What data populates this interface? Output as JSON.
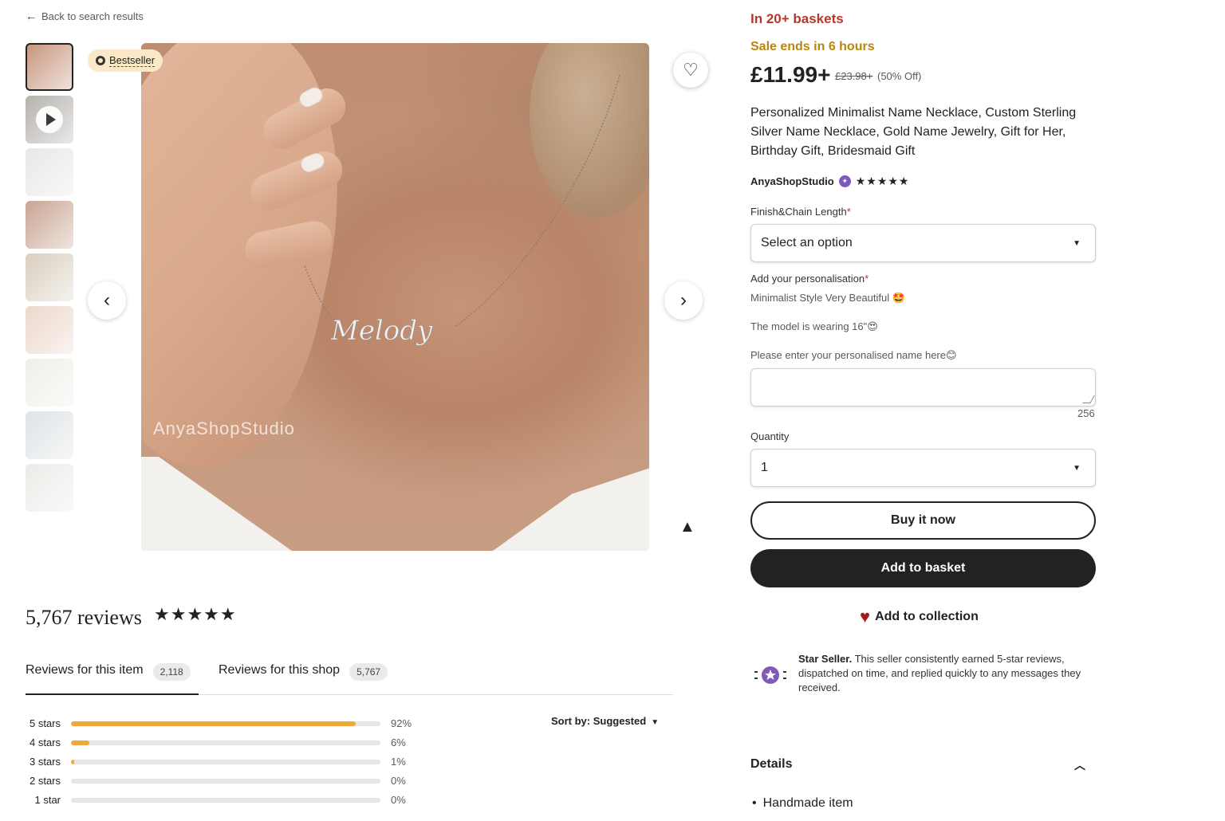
{
  "nav": {
    "back_label": "Back to search results"
  },
  "gallery": {
    "bestseller_label": "Bestseller",
    "watermark": "AnyaShopStudio",
    "necklace_name": "Melody",
    "thumbnails": [
      {
        "color": "#c7977e"
      },
      {
        "color": "#b5b1ad",
        "video": true
      },
      {
        "color": "#e9e7e6"
      },
      {
        "color": "#c9a592"
      },
      {
        "color": "#d9cfc0"
      },
      {
        "color": "#ecd8cc"
      },
      {
        "color": "#efeee9"
      },
      {
        "color": "#dfe3e6"
      },
      {
        "color": "#ecebe8"
      }
    ]
  },
  "reviews": {
    "count_label": "5,767 reviews",
    "stars": "★★★★★",
    "tabs": [
      {
        "label": "Reviews for this item",
        "count": "2,118"
      },
      {
        "label": "Reviews for this shop",
        "count": "5,767"
      }
    ],
    "sort_label": "Sort by: Suggested",
    "breakdown": [
      {
        "label": "5 stars",
        "percent": 92,
        "percent_label": "92%"
      },
      {
        "label": "4 stars",
        "percent": 6,
        "percent_label": "6%"
      },
      {
        "label": "3 stars",
        "percent": 1,
        "percent_label": "1%"
      },
      {
        "label": "2 stars",
        "percent": 0,
        "percent_label": "0%"
      },
      {
        "label": "1 star",
        "percent": 0,
        "percent_label": "0%"
      }
    ]
  },
  "product": {
    "baskets": "In 20+ baskets",
    "sale_ends": "Sale ends in 6 hours",
    "price": "£11.99+",
    "original_price": "£23.98+",
    "discount": "(50% Off)",
    "title": "Personalized Minimalist Name Necklace, Custom Sterling Silver Name Necklace, Gold Name Jewelry, Gift for Her, Birthday Gift, Bridesmaid Gift",
    "shop_name": "AnyaShopStudio",
    "shop_stars": "★★★★★",
    "finish_label": "Finish&Chain Length",
    "finish_value": "Select an option",
    "personalisation_label": "Add your personalisation",
    "hint_1": "Minimalist Style Very Beautiful 🤩",
    "hint_2": "The model is wearing 16\"😍",
    "hint_3": "Please enter your personalised name here😊",
    "char_limit": "256",
    "quantity_label": "Quantity",
    "quantity_value": "1",
    "buy_now": "Buy it now",
    "add_to_basket": "Add to basket",
    "add_to_collection": "Add to collection",
    "star_seller_title": "Star Seller.",
    "star_seller_text": "This seller consistently earned 5-star reviews, dispatched on time, and replied quickly to any messages they received.",
    "details_label": "Details",
    "details_items": [
      "Handmade item"
    ]
  },
  "colors": {
    "accent_red": "#b7372c",
    "sale_gold": "#b8860b",
    "rating_bar": "#f1a83b",
    "dark_button": "#222222",
    "star_seller_purple": "#7f5ab6"
  }
}
